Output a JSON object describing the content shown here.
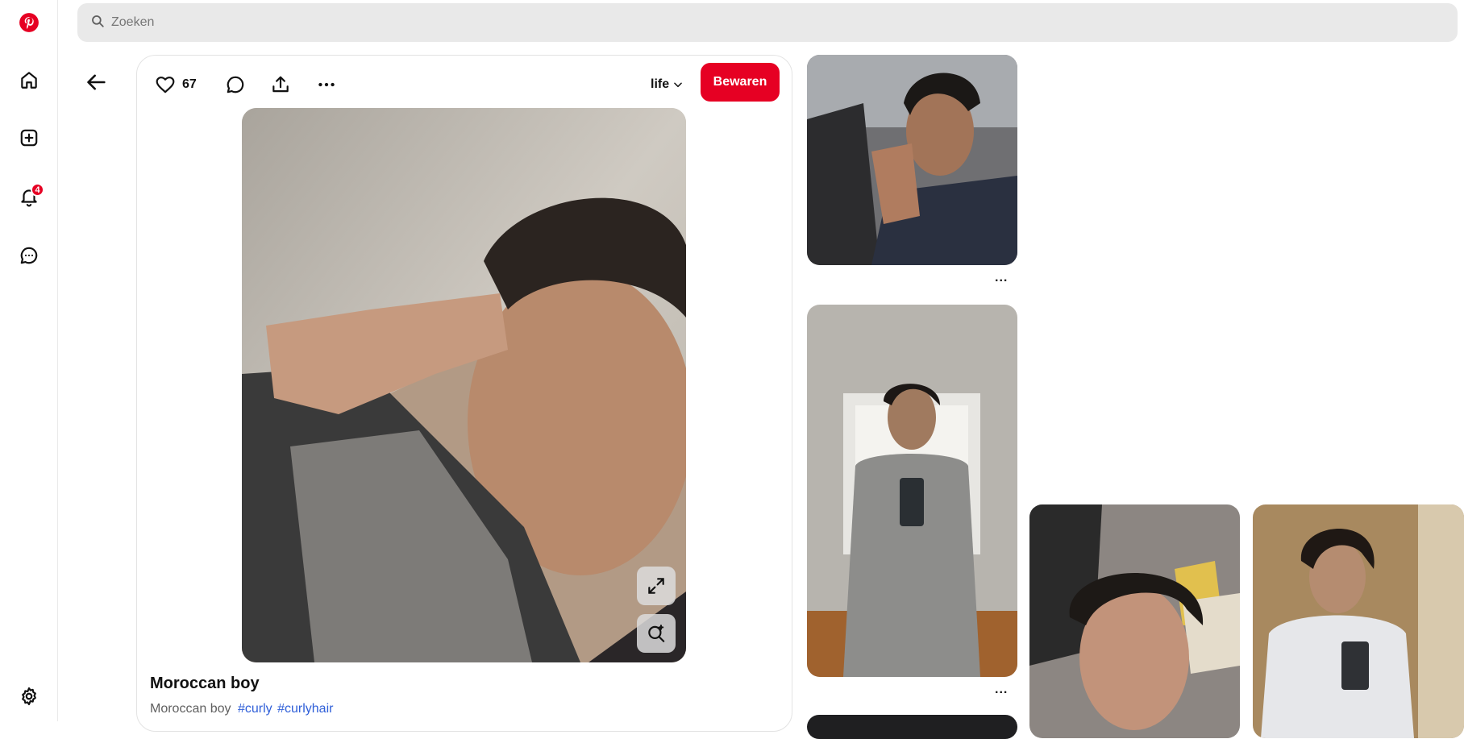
{
  "search": {
    "placeholder": "Zoeken"
  },
  "sidebar": {
    "notification_count": "4",
    "icons": [
      "pinterest-logo-icon",
      "home-icon",
      "create-icon",
      "bell-icon",
      "messages-icon",
      "settings-icon"
    ]
  },
  "pin": {
    "like_count": "67",
    "board_name": "life",
    "save_label": "Bewaren",
    "title": "Moroccan boy",
    "description": "Moroccan boy",
    "hashtags": [
      "#curly",
      "#curlyhair"
    ]
  },
  "related": {
    "more_label": "..."
  },
  "colors": {
    "brand_red": "#e60023",
    "search_bg": "#e9e9e9",
    "hashtag_blue": "#2f5fd8"
  }
}
